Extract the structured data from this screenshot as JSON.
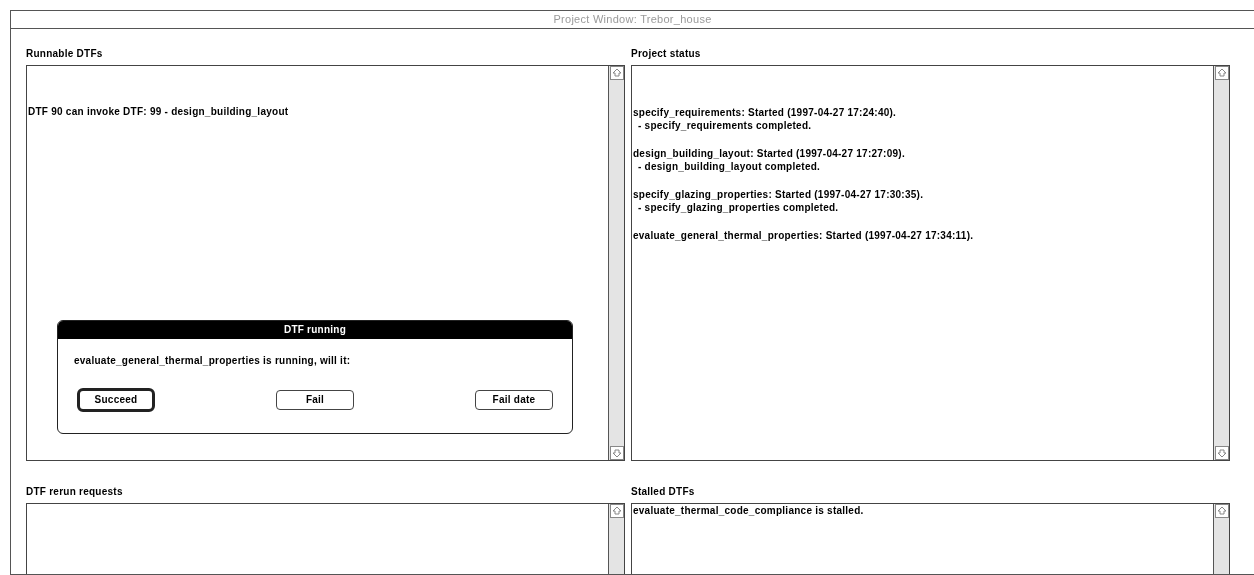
{
  "window": {
    "title": "Project Window: Trebor_house"
  },
  "runnable_dtfs": {
    "label": "Runnable DTFs",
    "lines": [
      "DTF 90 can invoke DTF: 99 - design_building_layout"
    ]
  },
  "project_status": {
    "label": "Project status",
    "entries": [
      {
        "started": "specify_requirements: Started (1997-04-27 17:24:40).",
        "completed": "- specify_requirements completed."
      },
      {
        "started": "design_building_layout: Started (1997-04-27 17:27:09).",
        "completed": "- design_building_layout completed."
      },
      {
        "started": "specify_glazing_properties: Started (1997-04-27 17:30:35).",
        "completed": "- specify_glazing_properties completed."
      },
      {
        "started": "evaluate_general_thermal_properties: Started (1997-04-27 17:34:11)."
      }
    ]
  },
  "dialog": {
    "title": "DTF running",
    "message": "evaluate_general_thermal_properties is running, will it:",
    "buttons": [
      {
        "label": "Succeed",
        "default": true
      },
      {
        "label": "Fail",
        "default": false
      },
      {
        "label": "Fail date",
        "default": false
      }
    ]
  },
  "dtf_rerun_requests": {
    "label": "DTF rerun requests"
  },
  "stalled_dtfs": {
    "label": "Stalled DTFs",
    "lines": [
      "evaluate_thermal_code_compliance is stalled."
    ]
  }
}
